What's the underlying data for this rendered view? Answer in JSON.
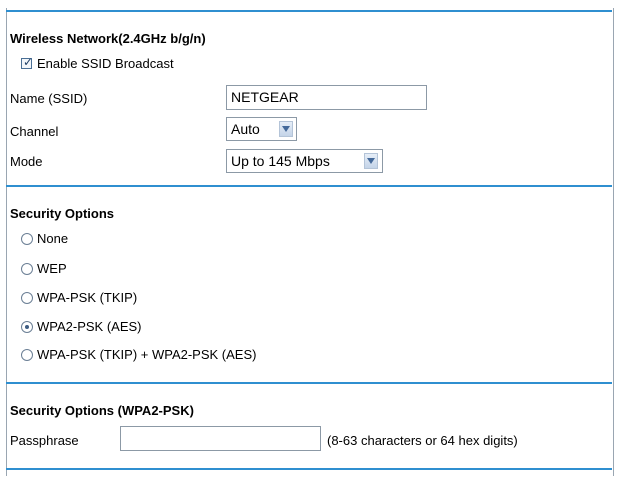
{
  "wireless": {
    "heading": "Wireless Network(2.4GHz b/g/n)",
    "enable_ssid_label": "Enable SSID Broadcast",
    "enable_ssid_checked": true,
    "ssid_label": "Name (SSID)",
    "ssid_value": "NETGEAR",
    "channel_label": "Channel",
    "channel_value": "Auto",
    "mode_label": "Mode",
    "mode_value": "Up to 145 Mbps"
  },
  "security": {
    "heading": "Security Options",
    "options": [
      {
        "label": "None",
        "selected": false
      },
      {
        "label": "WEP",
        "selected": false
      },
      {
        "label": "WPA-PSK (TKIP)",
        "selected": false
      },
      {
        "label": "WPA2-PSK (AES)",
        "selected": true
      },
      {
        "label": "WPA-PSK (TKIP) + WPA2-PSK (AES)",
        "selected": false
      }
    ]
  },
  "wpa2": {
    "heading": "Security Options (WPA2-PSK)",
    "passphrase_label": "Passphrase",
    "passphrase_value": "",
    "passphrase_hint": "(8-63 characters or 64 hex digits)"
  },
  "colors": {
    "divider": "#2f8fd0",
    "frame_border": "#9aa6b2"
  },
  "icons": {
    "checkbox_mark": "check-icon",
    "select_arrow": "chevron-down-icon"
  }
}
